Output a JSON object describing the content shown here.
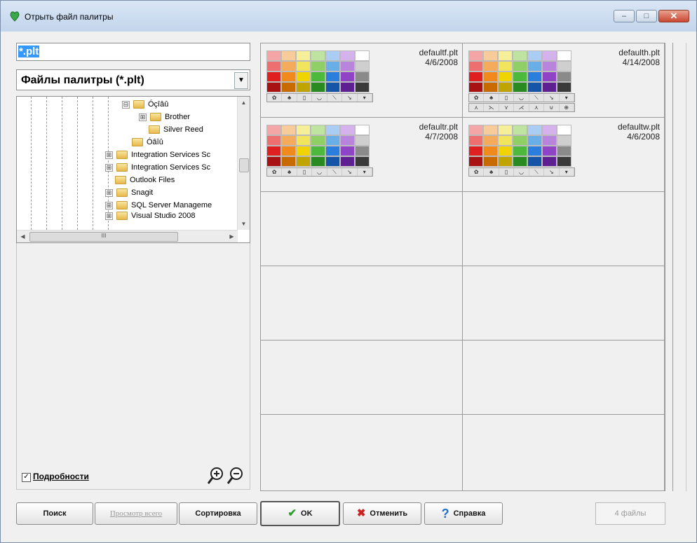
{
  "window": {
    "title": "Отрыть файл палитры",
    "controls": {
      "minimize": "–",
      "maximize": "□",
      "close": "✕"
    }
  },
  "left_panel": {
    "filename_value": "*.plt",
    "filetype_value": "Файлы палитры (*.plt)",
    "tree": [
      {
        "label": "Óçîâû",
        "expander": "⊟"
      },
      {
        "label": "Brother",
        "expander": "⊞"
      },
      {
        "label": "Silver Reed",
        "expander": ""
      },
      {
        "label": "Óâîû",
        "expander": ""
      },
      {
        "label": "Integration Services Sc",
        "expander": "⊞"
      },
      {
        "label": "Integration Services Sc",
        "expander": "⊞"
      },
      {
        "label": "Outlook Files",
        "expander": ""
      },
      {
        "label": "Snagit",
        "expander": "⊞"
      },
      {
        "label": "SQL Server Manageme",
        "expander": "⊞"
      },
      {
        "label": "Visual Studio 2008",
        "expander": "⊞"
      }
    ],
    "hscroll_grip": "III",
    "details_checked": "✓",
    "details_label": "Подробности"
  },
  "palette_files": [
    {
      "name": "defaultf.plt",
      "date": "4/6/2008",
      "tools_rows": 1
    },
    {
      "name": "defaulth.plt",
      "date": "4/14/2008",
      "tools_rows": 2
    },
    {
      "name": "defaultr.plt",
      "date": "4/7/2008",
      "tools_rows": 1
    },
    {
      "name": "defaultw.plt",
      "date": "4/6/2008",
      "tools_rows": 1
    }
  ],
  "palette_colors": [
    [
      "#f4a6a6",
      "#f8cc9a",
      "#f6ef9a",
      "#bfe3a0",
      "#a9cdf4",
      "#d6b2ec",
      "#ffffff"
    ],
    [
      "#ee6f6f",
      "#f4ac5c",
      "#f2e55e",
      "#90cf66",
      "#6aaee8",
      "#b884dc",
      "#cfcfcf"
    ],
    [
      "#e02020",
      "#f08a1c",
      "#f0d400",
      "#4cb83c",
      "#2a7ede",
      "#8e44c4",
      "#8a8a8a"
    ],
    [
      "#a81212",
      "#c86a00",
      "#c0a400",
      "#2a8a22",
      "#1455a8",
      "#5e2090",
      "#3a3a3a"
    ]
  ],
  "palette_tools": [
    "✿",
    "♣",
    "▯",
    "◡",
    "⟍",
    "↘",
    "▾"
  ],
  "palette_tools_extra": [
    "⋏",
    "⋋",
    "⋎",
    "⋌",
    "⋏",
    "⊍",
    "⊕"
  ],
  "buttons": {
    "search": "Поиск",
    "view_all": "Просмотр всего",
    "sort": "Сортировка",
    "ok": "OK",
    "cancel": "Отменить",
    "help": "Справка"
  },
  "status": "4 файлы",
  "colors": {
    "ok_check": "#2c9e2c",
    "cancel_x": "#cc2222",
    "help_q": "#1f6fd0",
    "selection": "#3399ff"
  }
}
